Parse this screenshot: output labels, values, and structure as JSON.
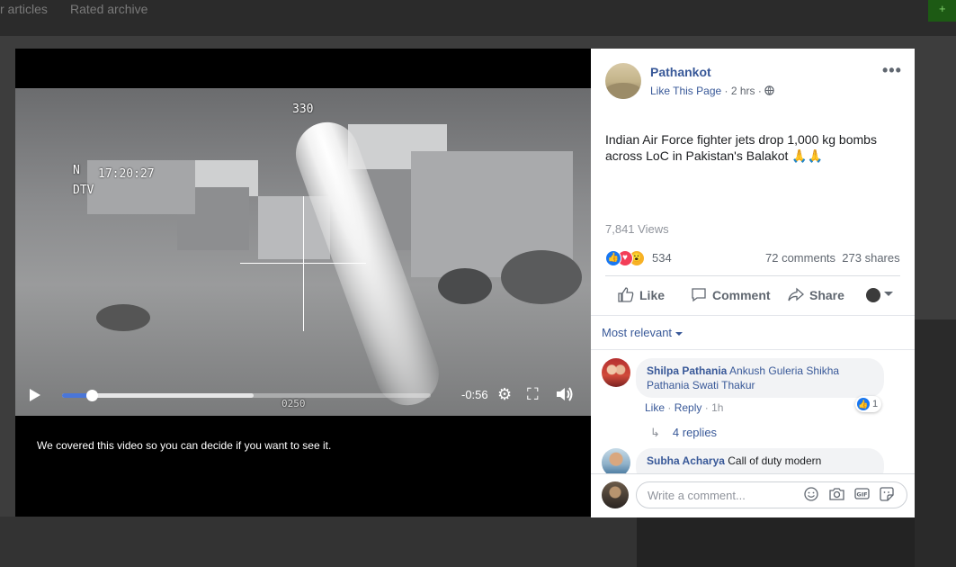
{
  "background": {
    "tabs": [
      "r articles",
      "Rated archive"
    ],
    "green_button": "+"
  },
  "video": {
    "overlay_top_number": "330",
    "overlay_n": "N",
    "overlay_dtv": "DTV",
    "overlay_time": "17:20:27",
    "overlay_bottom": "0250",
    "time_remaining": "-0:56",
    "progress_played": 0.08,
    "progress_buffered": 0.52,
    "notice": "We covered this video so you can decide if you want to see it."
  },
  "post": {
    "page_name": "Pathankot",
    "like_link": "Like This Page",
    "separator": "·",
    "time": "2 hrs",
    "text": "Indian Air Force fighter jets drop 1,000 kg bombs across LoC in Pakistan's Balakot 🙏🙏",
    "views": "7,841 Views",
    "reaction_count": "534",
    "comments": "72 comments",
    "shares": "273 shares"
  },
  "actions": {
    "like": "Like",
    "comment": "Comment",
    "share": "Share"
  },
  "comments_section": {
    "sort_label": "Most relevant",
    "comments": [
      {
        "name": "Shilpa Pathania",
        "text": "Ankush Guleria Shikha Pathania Swati Thakur",
        "like": "Like",
        "reply": "Reply",
        "time": "1h",
        "reaction_count": "1",
        "replies": "4 replies"
      },
      {
        "name": "Subha Acharya",
        "text": "Call of duty modern"
      }
    ],
    "composer_placeholder": "Write a comment..."
  },
  "icons": [
    "play-icon",
    "settings-icon",
    "fullscreen-icon",
    "volume-icon",
    "globe-icon",
    "more-icon",
    "like-icon",
    "comment-icon",
    "share-icon",
    "emoji-icon",
    "camera-icon",
    "gif-icon",
    "sticker-icon"
  ],
  "colors": {
    "link_blue": "#385898",
    "fb_blue": "#1877f2",
    "scrub_blue": "#4a76d8"
  }
}
